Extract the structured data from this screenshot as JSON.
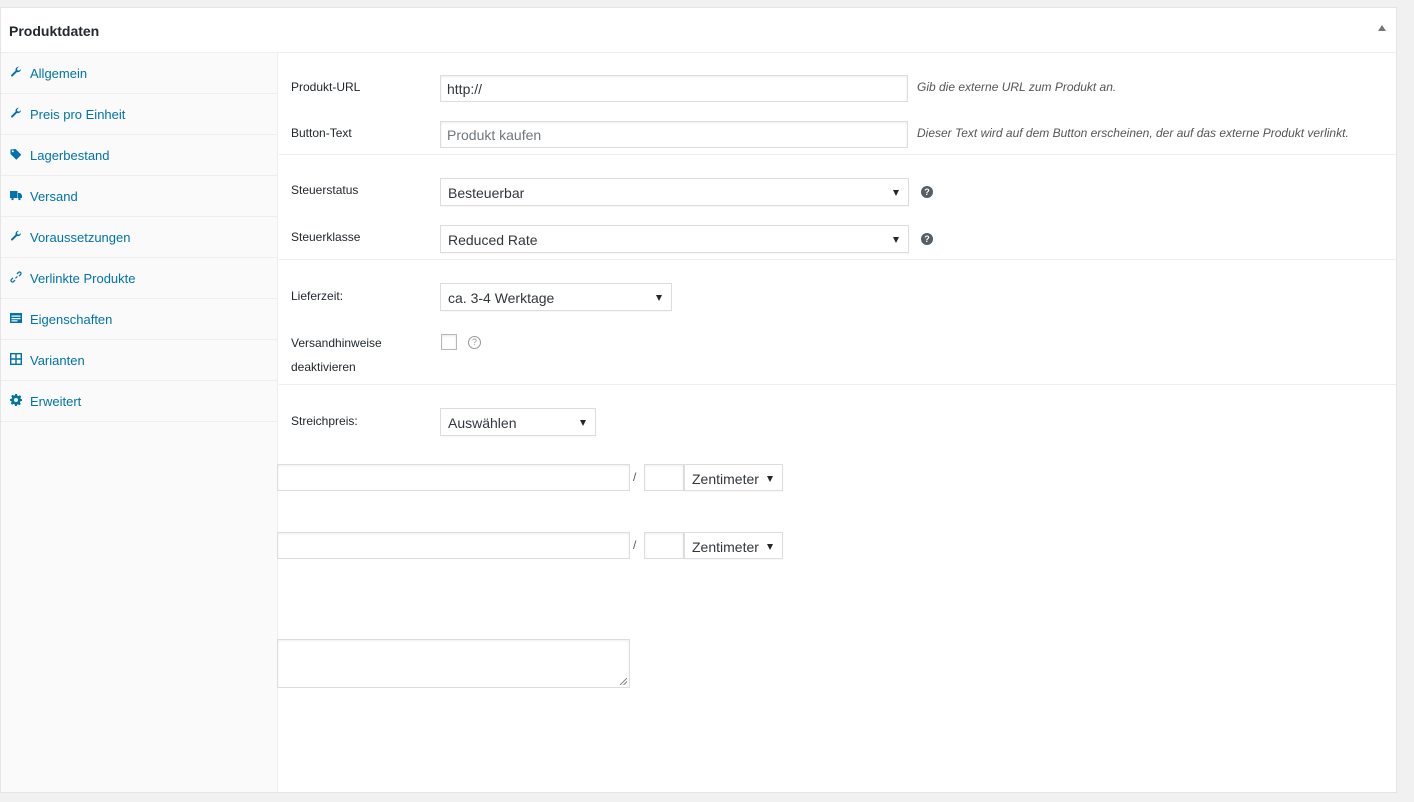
{
  "panel": {
    "title": "Produktdaten",
    "toggle_icon": "arrow-up-icon"
  },
  "tabs": [
    {
      "label": "Allgemein",
      "icon": "wrench-icon"
    },
    {
      "label": "Preis pro Einheit",
      "icon": "wrench-icon"
    },
    {
      "label": "Lagerbestand",
      "icon": "tag-icon"
    },
    {
      "label": "Versand",
      "icon": "truck-icon"
    },
    {
      "label": "Voraussetzungen",
      "icon": "wrench-icon"
    },
    {
      "label": "Verlinkte Produkte",
      "icon": "link-icon"
    },
    {
      "label": "Eigenschaften",
      "icon": "list-icon"
    },
    {
      "label": "Varianten",
      "icon": "grid-icon"
    },
    {
      "label": "Erweitert",
      "icon": "gear-icon"
    }
  ],
  "external": {
    "product_url_label": "Produkt-URL",
    "product_url_value": "http://",
    "product_url_desc": "Gib die externe URL zum Produkt an.",
    "button_text_label": "Button-Text",
    "button_text_placeholder": "Produkt kaufen",
    "button_text_desc": "Dieser Text wird auf dem Button erscheinen, der auf das externe Produkt verlinkt."
  },
  "tax": {
    "status_label": "Steuerstatus",
    "status_value": "Besteuerbar",
    "class_label": "Steuerklasse",
    "class_value": "Reduced Rate"
  },
  "delivery": {
    "time_label": "Lieferzeit:",
    "time_value": "ca. 3-4 Werktage",
    "shipping_notes_label_1": "Versandhinweise",
    "shipping_notes_label_2": "deaktivieren",
    "help_glyph": "?"
  },
  "strike": {
    "label": "Streichpreis:",
    "value": "Auswählen"
  },
  "units": {
    "separator": "/",
    "unit_1": "Zentimeter",
    "unit_2": "Zentimeter"
  },
  "colors": {
    "link": "#0073aa",
    "border": "#dddddd"
  }
}
